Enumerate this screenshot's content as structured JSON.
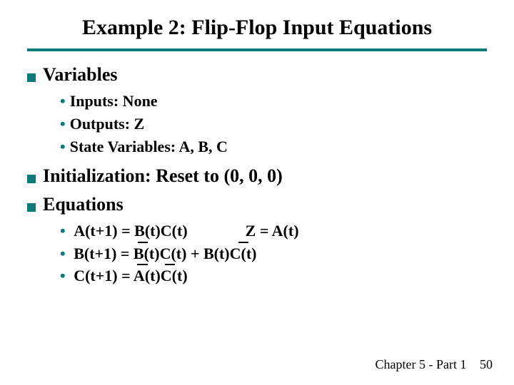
{
  "title": "Example 2: Flip-Flop Input Equations",
  "sections": {
    "variables": {
      "heading": "Variables",
      "items": {
        "inputs": "Inputs: None",
        "outputs": "Outputs: Z",
        "state": "State Variables: A, B, C"
      }
    },
    "initialization": {
      "heading": "Initialization: Reset to (0, 0, 0)"
    },
    "equations": {
      "heading": "Equations",
      "items": {
        "eqA": "A(t+1) = B(t)C(t)",
        "eqA_out": "Z = A(t)",
        "eqB": "B(t+1) = B(t)C(t) + B(t)C(t)",
        "eqB_overlines": [
          "first B",
          "second C"
        ],
        "eqC": "C(t+1) = A(t)C(t)",
        "eqC_overlines": [
          "A",
          "C"
        ]
      }
    }
  },
  "footer": {
    "chapter": "Chapter 5 - Part 1",
    "page": "50"
  },
  "colors": {
    "accent_teal": "#0b7a7a"
  }
}
